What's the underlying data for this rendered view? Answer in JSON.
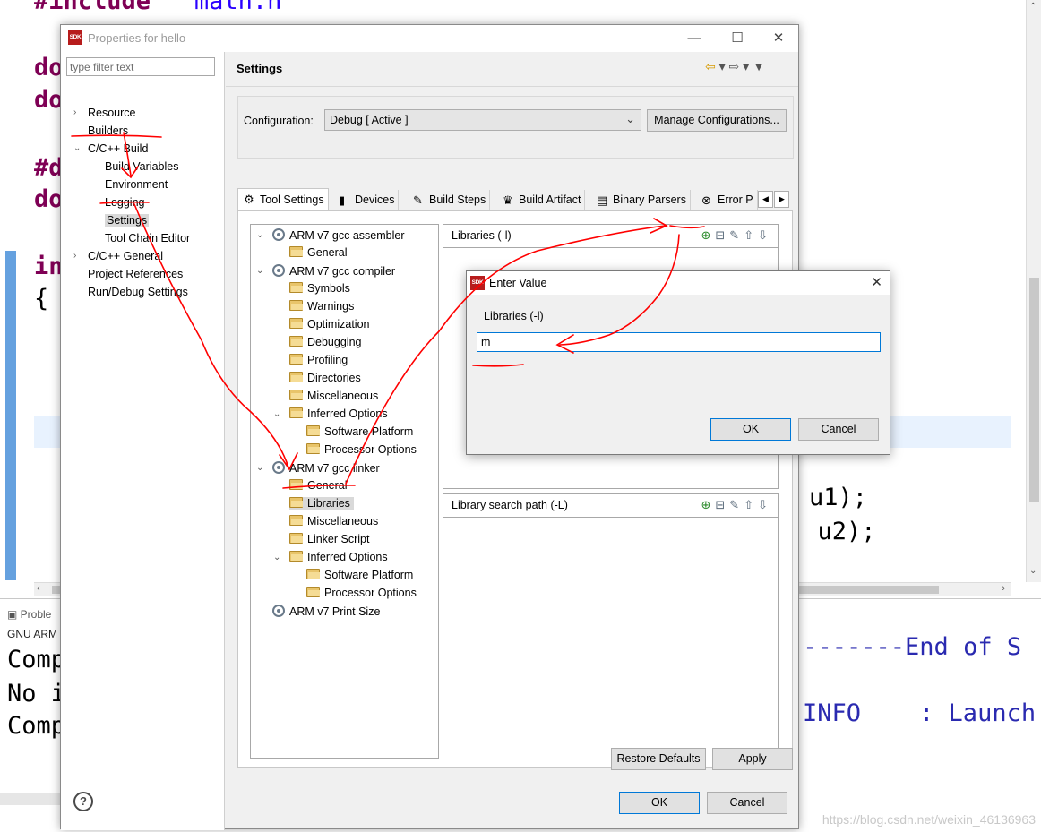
{
  "editor": {
    "lines": [
      {
        "kw": "#include",
        "str": "\"math.h\""
      },
      {
        "kw": "do",
        "str": ""
      },
      {
        "kw": "do",
        "str": ""
      },
      {
        "kw": "#d",
        "str": ""
      },
      {
        "kw": "do",
        "str": ""
      },
      {
        "kw": "in",
        "str": ""
      }
    ],
    "brace": "{",
    "fragment1": "u1);",
    "fragment2": ", u2);"
  },
  "console": {
    "tab_label": "Proble",
    "title": "GNU ARM",
    "lines_left": [
      "Comp",
      "No i",
      "Comp"
    ],
    "lines_right": [
      "--------End of S",
      "INFO    : Launch"
    ]
  },
  "dialog": {
    "title": "Properties for hello",
    "logo_text": "SDK",
    "filter_placeholder": "type filter text",
    "nav": [
      {
        "label": "Resource",
        "twisty": "›"
      },
      {
        "label": "Builders",
        "twisty": ""
      },
      {
        "label": "C/C++ Build",
        "twisty": "⌄"
      },
      {
        "label": "Build Variables",
        "twisty": ""
      },
      {
        "label": "Environment",
        "twisty": ""
      },
      {
        "label": "Logging",
        "twisty": ""
      },
      {
        "label": "Settings",
        "twisty": ""
      },
      {
        "label": "Tool Chain Editor",
        "twisty": ""
      },
      {
        "label": "C/C++ General",
        "twisty": "›"
      },
      {
        "label": "Project References",
        "twisty": ""
      },
      {
        "label": "Run/Debug Settings",
        "twisty": ""
      }
    ],
    "page_title": "Settings",
    "config_label": "Configuration:",
    "config_value": "Debug  [ Active ]",
    "manage_button": "Manage Configurations...",
    "tabs": [
      {
        "label": "Tool Settings",
        "icon": "⚙"
      },
      {
        "label": "Devices",
        "icon": "▮"
      },
      {
        "label": "Build Steps",
        "icon": "✎"
      },
      {
        "label": "Build Artifact",
        "icon": "♛"
      },
      {
        "label": "Binary Parsers",
        "icon": "▤"
      },
      {
        "label": "Error P",
        "icon": "⊗"
      }
    ],
    "tree": [
      {
        "label": "ARM v7 gcc assembler",
        "twisty": "⌄",
        "icon": "gear"
      },
      {
        "label": "General",
        "twisty": "",
        "icon": "folder"
      },
      {
        "label": "ARM v7 gcc compiler",
        "twisty": "⌄",
        "icon": "gear"
      },
      {
        "label": "Symbols",
        "twisty": "",
        "icon": "folder"
      },
      {
        "label": "Warnings",
        "twisty": "",
        "icon": "folder"
      },
      {
        "label": "Optimization",
        "twisty": "",
        "icon": "folder"
      },
      {
        "label": "Debugging",
        "twisty": "",
        "icon": "folder"
      },
      {
        "label": "Profiling",
        "twisty": "",
        "icon": "folder"
      },
      {
        "label": "Directories",
        "twisty": "",
        "icon": "folder"
      },
      {
        "label": "Miscellaneous",
        "twisty": "",
        "icon": "folder"
      },
      {
        "label": "Inferred Options",
        "twisty": "⌄",
        "icon": "folder"
      },
      {
        "label": "Software Platform",
        "twisty": "",
        "icon": "folder"
      },
      {
        "label": "Processor Options",
        "twisty": "",
        "icon": "folder"
      },
      {
        "label": "ARM v7 gcc linker",
        "twisty": "⌄",
        "icon": "gear"
      },
      {
        "label": "General",
        "twisty": "",
        "icon": "folder"
      },
      {
        "label": "Libraries",
        "twisty": "",
        "icon": "folder"
      },
      {
        "label": "Miscellaneous",
        "twisty": "",
        "icon": "folder"
      },
      {
        "label": "Linker Script",
        "twisty": "",
        "icon": "folder"
      },
      {
        "label": "Inferred Options",
        "twisty": "⌄",
        "icon": "folder"
      },
      {
        "label": "Software Platform",
        "twisty": "",
        "icon": "folder"
      },
      {
        "label": "Processor Options",
        "twisty": "",
        "icon": "folder"
      },
      {
        "label": "ARM v7 Print Size",
        "twisty": "",
        "icon": "gear"
      }
    ],
    "libraries_title": "Libraries (-l)",
    "libsearch_title": "Library search path (-L)",
    "restore_button": "Restore Defaults",
    "apply_button": "Apply",
    "ok_button": "OK",
    "cancel_button": "Cancel",
    "help_glyph": "?"
  },
  "enter_value": {
    "title": "Enter Value",
    "logo_text": "SDK",
    "label": "Libraries (-l)",
    "value": "m",
    "ok_button": "OK",
    "cancel_button": "Cancel"
  },
  "watermark": "https://blog.csdn.net/weixin_46136963",
  "colors": {
    "accent": "#0078d7",
    "annotation": "#ff0000",
    "keyword": "#7f0055",
    "string": "#2a00ff"
  }
}
